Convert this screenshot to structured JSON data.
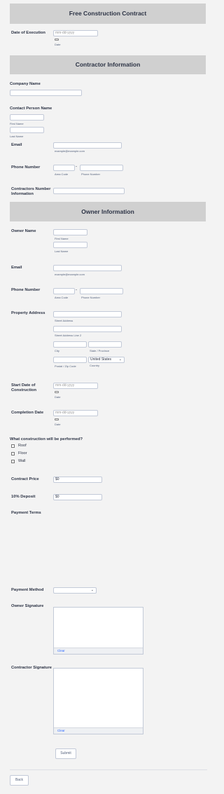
{
  "sections": {
    "title": "Free Construction Contract",
    "contractor_info": "Contractor Information",
    "owner_info": "Owner Information"
  },
  "date_of_execution": {
    "label": "Date of Execution",
    "placeholder": "mm-dd-yyyy",
    "sub": "Date"
  },
  "company_name": {
    "label": "Company Name"
  },
  "contact_person": {
    "label": "Contact Person Name",
    "first": "First Name",
    "last": "Last Name"
  },
  "contractor_email": {
    "label": "Email",
    "sub": "example@example.com"
  },
  "contractor_phone": {
    "label": "Phone Number",
    "area": "Area Code",
    "phone": "Phone Number",
    "dash": "-"
  },
  "contractors_number": {
    "label_line1": "Contractors Number",
    "label_line2": "Information"
  },
  "owner_name": {
    "label": "Owner Name",
    "first": "First Name",
    "last": "Last Name"
  },
  "owner_email": {
    "label": "Email",
    "sub": "example@example.com"
  },
  "owner_phone": {
    "label": "Phone Number",
    "area": "Area Code",
    "phone": "Phone Number",
    "dash": "-"
  },
  "property_address": {
    "label": "Property Address",
    "street": "Street Address",
    "street2": "Street Address Line 2",
    "city": "City",
    "state": "State / Province",
    "postal": "Postal / Zip Code",
    "country_label": "Country",
    "country_value": "United States"
  },
  "start_date": {
    "label_line1": "Start Date of",
    "label_line2": "Construction",
    "placeholder": "mm-dd-yyyy",
    "sub": "Date"
  },
  "completion_date": {
    "label": "Completion Date",
    "placeholder": "mm-dd-yyyy",
    "sub": "Date"
  },
  "construction_type": {
    "label": "What construction will be performed?",
    "options": [
      "Roof",
      "Floor",
      "Wall"
    ]
  },
  "contract_price": {
    "label": "Contract Price",
    "value": "$0"
  },
  "deposit": {
    "label": "10% Deposit",
    "value": "$0"
  },
  "payment_terms": {
    "label": "Payment Terms"
  },
  "payment_method": {
    "label": "Payment Method",
    "value": ""
  },
  "owner_signature": {
    "label": "Owner Signature",
    "clear": "Clear"
  },
  "contractor_signature": {
    "label": "Contractor Signature",
    "clear": "Clear"
  },
  "buttons": {
    "submit": "Submit",
    "back": "Back"
  }
}
